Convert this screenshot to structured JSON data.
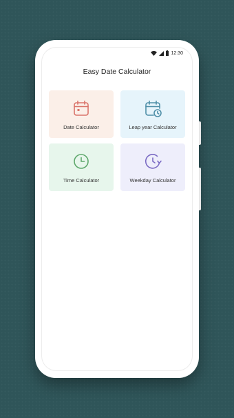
{
  "status_bar": {
    "time": "12:30"
  },
  "app": {
    "title": "Easy Date Calculator"
  },
  "cards": [
    {
      "label": "Date Calculator",
      "icon": "calendar-icon",
      "bg": "#fbefe8",
      "color": "#d9746a"
    },
    {
      "label": "Leap year Calculator",
      "icon": "calendar-clock-icon",
      "bg": "#e6f4fb",
      "color": "#4f8fa8"
    },
    {
      "label": "Time Calculator",
      "icon": "clock-icon",
      "bg": "#e7f6ec",
      "color": "#5ea86c"
    },
    {
      "label": "Weekday Calculator",
      "icon": "clock-refresh-icon",
      "bg": "#eeeefb",
      "color": "#7b6bc4"
    }
  ]
}
